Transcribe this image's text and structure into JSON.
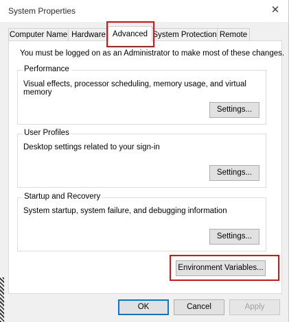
{
  "window": {
    "title": "System Properties",
    "close_glyph": "✕"
  },
  "tabs": [
    {
      "label": "Computer Name"
    },
    {
      "label": "Hardware"
    },
    {
      "label": "Advanced"
    },
    {
      "label": "System Protection"
    },
    {
      "label": "Remote"
    }
  ],
  "notice": "You must be logged on as an Administrator to make most of these changes.",
  "performance": {
    "title": "Performance",
    "description": "Visual effects, processor scheduling, memory usage, and virtual memory",
    "button": "Settings..."
  },
  "user_profiles": {
    "title": "User Profiles",
    "description": "Desktop settings related to your sign-in",
    "button": "Settings..."
  },
  "startup_recovery": {
    "title": "Startup and Recovery",
    "description": "System startup, system failure, and debugging information",
    "button": "Settings..."
  },
  "env_vars_button": "Environment Variables...",
  "footer": {
    "ok": "OK",
    "cancel": "Cancel",
    "apply": "Apply"
  },
  "colors": {
    "highlight": "#e01010",
    "focus": "#0078d7"
  }
}
